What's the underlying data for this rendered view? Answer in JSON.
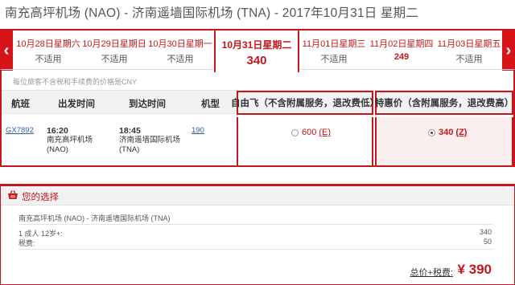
{
  "route_title": "南充高坪机场 (NAO) - 济南遥墙国际机场 (TNA) - 2017年10月31日 星期二",
  "date_bar": {
    "prev_arrow": "‹",
    "next_arrow": "›",
    "dates": [
      {
        "label": "10月28日星期六",
        "price": "不适用",
        "selected": false
      },
      {
        "label": "10月29日星期日",
        "price": "不适用",
        "selected": false
      },
      {
        "label": "10月30日星期一",
        "price": "不适用",
        "selected": false
      },
      {
        "label": "10月31日星期二",
        "price": "340",
        "selected": true
      },
      {
        "label": "11月01日星期三",
        "price": "不适用",
        "selected": false
      },
      {
        "label": "11月02日星期四",
        "price": "249",
        "selected": false
      },
      {
        "label": "11月03日星期五",
        "price": "不适用",
        "selected": false
      }
    ]
  },
  "price_note": "每位旅客不含税和手续费的价格是CNY",
  "table": {
    "headers": {
      "flight": "航班",
      "depart": "出发时间",
      "arrive": "到达时间",
      "aircraft": "机型"
    },
    "fare_headers": {
      "free": "自由飞（不含附属服务，退改费低）",
      "special": "特惠价（含附属服务，退改费高）"
    },
    "row": {
      "flight_no": "GX7892",
      "depart_time": "16:20",
      "depart_airport": "南充高坪机场",
      "depart_code": "(NAO)",
      "arrive_time": "18:45",
      "arrive_airport": "济南遥墙国际机场",
      "arrive_code": "(TNA)",
      "aircraft": "190",
      "free_price": "600",
      "free_class": "(E)",
      "special_price": "340",
      "special_class": "(Z)"
    }
  },
  "choice": {
    "title": "您的选择",
    "route": "南充高坪机场 (NAO) - 济南遥墙国际机场 (TNA)",
    "passenger_label": "1 成人  12岁+:",
    "passenger_value": "340",
    "tax_label": "税费:",
    "tax_value": "50",
    "total_label": "总价+税费:",
    "total_value": "¥ 390"
  }
}
